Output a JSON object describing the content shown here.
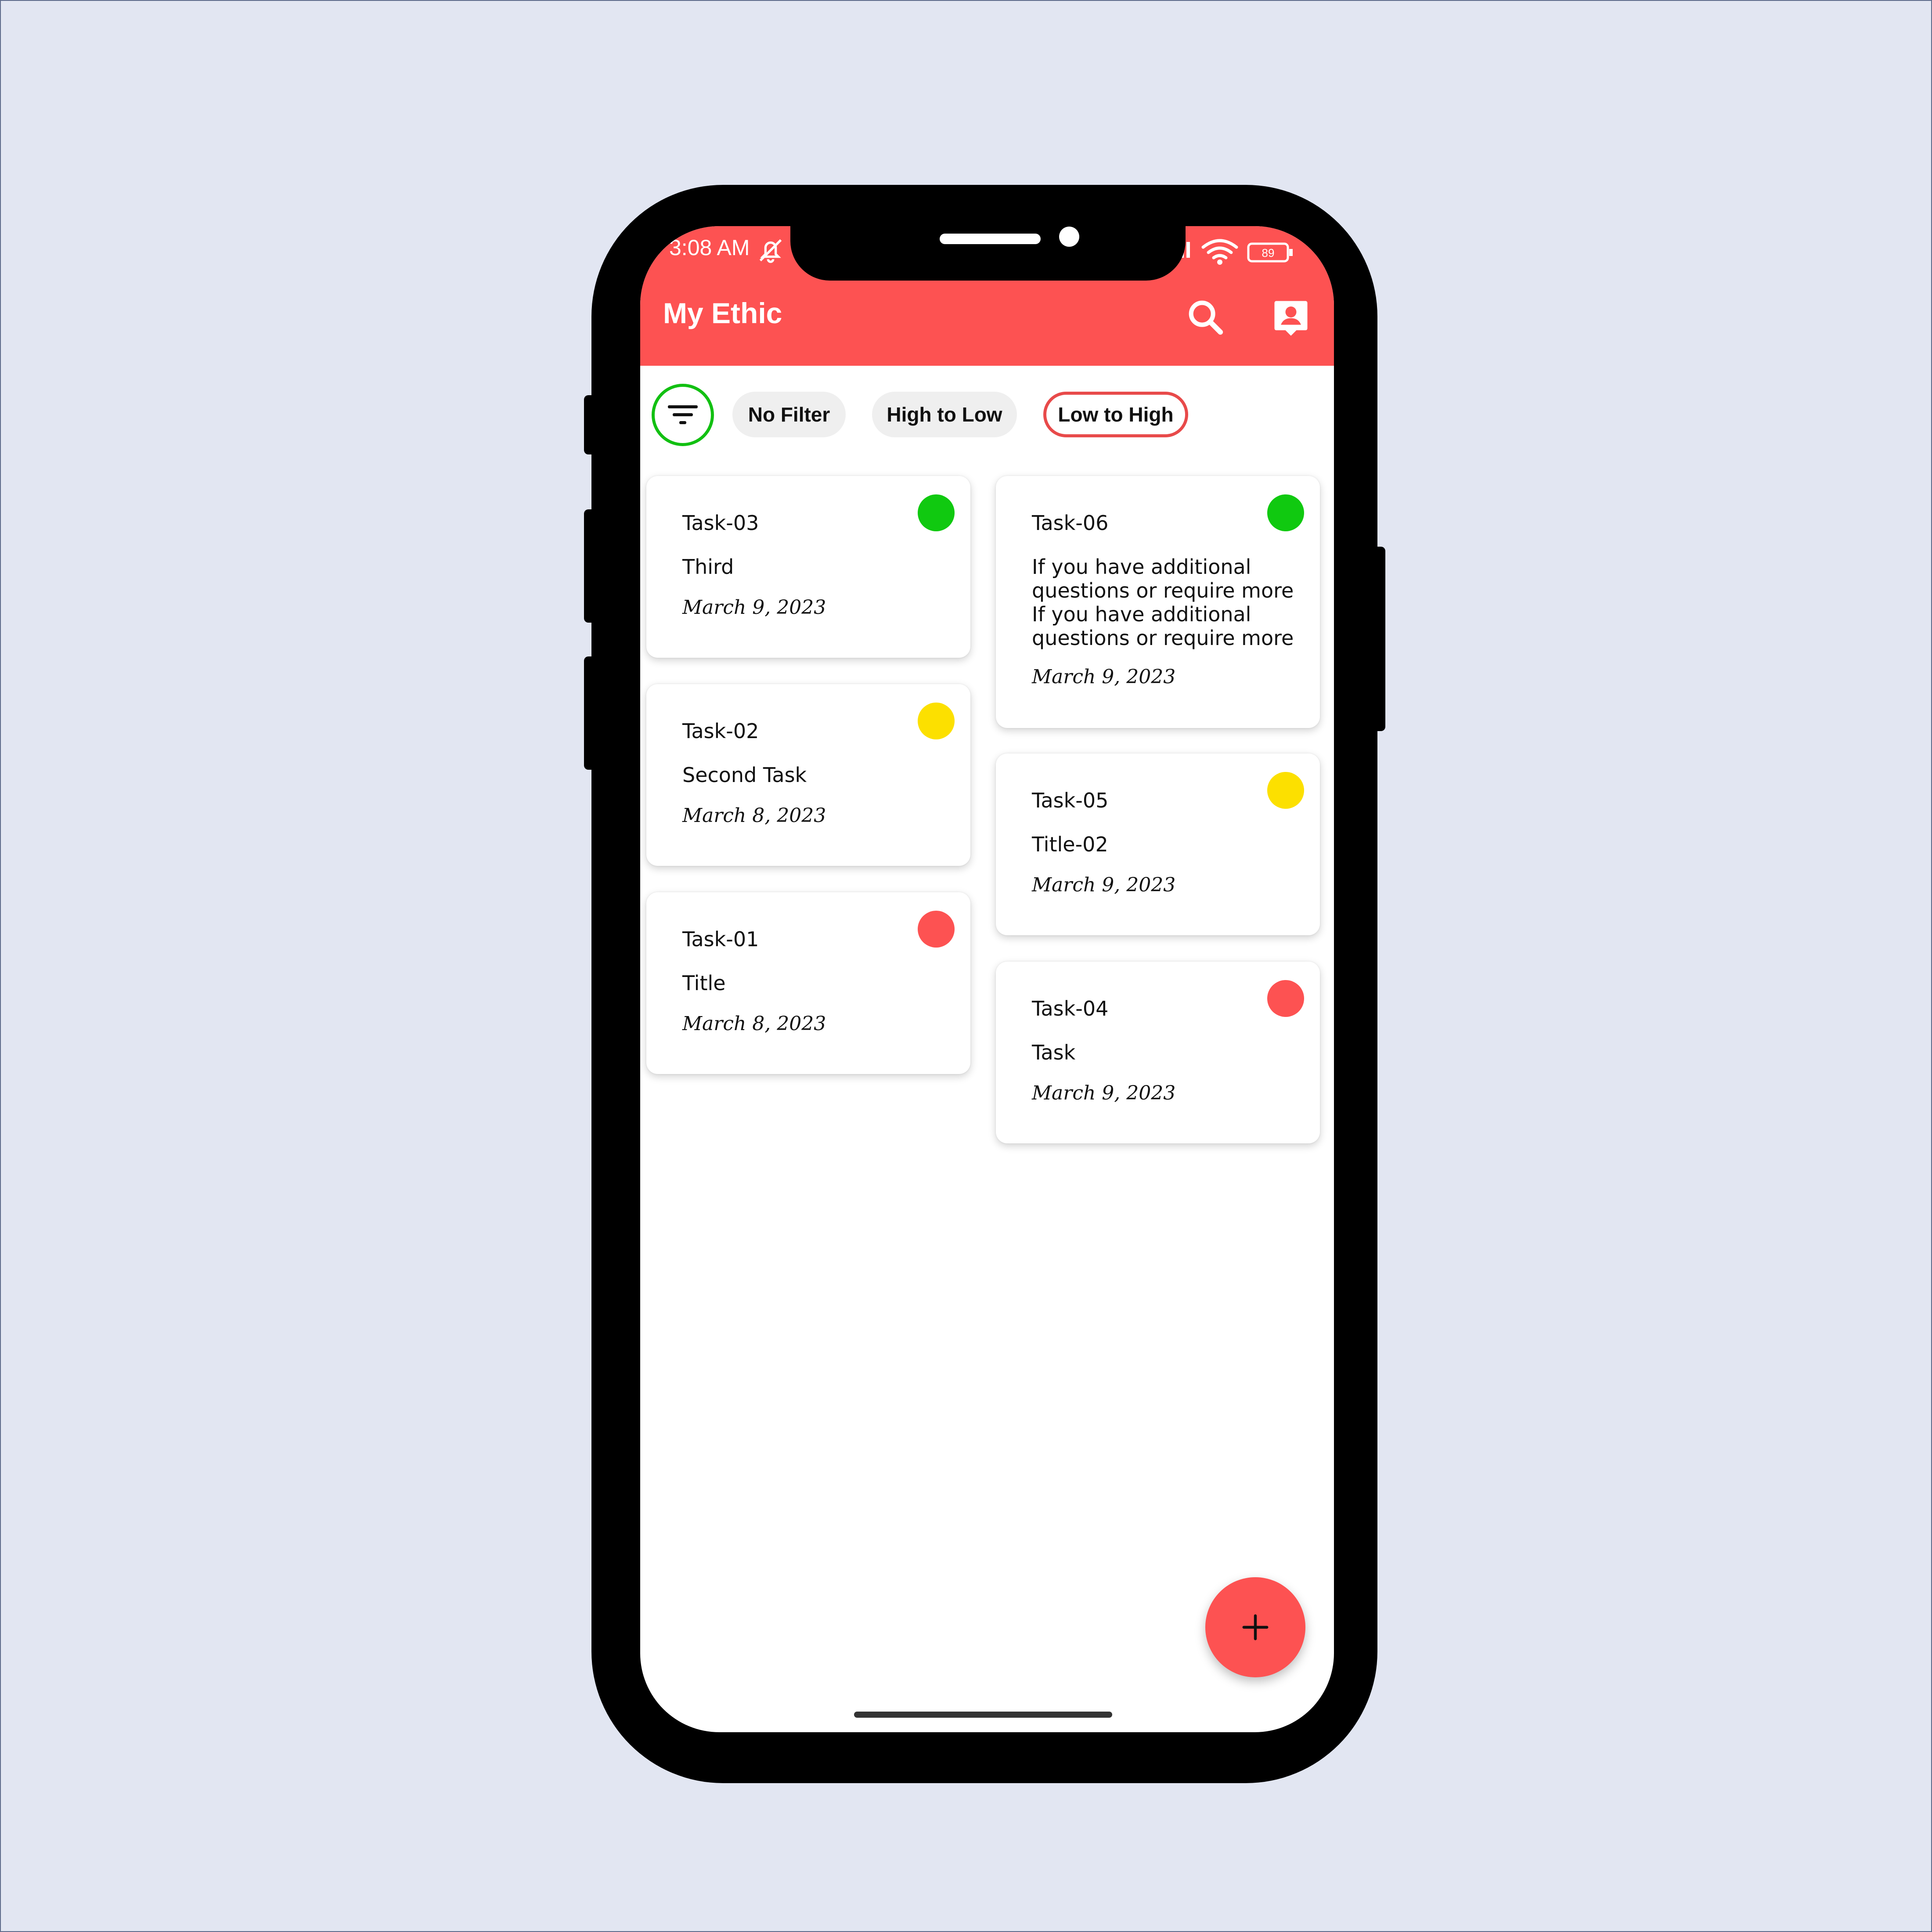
{
  "status_bar": {
    "time": "3:08 AM",
    "battery": "89"
  },
  "app_bar": {
    "title": "My Ethic",
    "search_icon": "search-icon",
    "profile_icon": "account-box-icon"
  },
  "filters": {
    "icon": "filter-list-icon",
    "options": [
      "No Filter",
      "High to Low",
      "Low to High"
    ],
    "selected": "Low to High"
  },
  "tasks_left": [
    {
      "name": "Task-03",
      "desc": "Third",
      "date": "March 9, 2023",
      "priority_color": "#10c910"
    },
    {
      "name": "Task-02",
      "desc": "Second Task",
      "date": "March 8, 2023",
      "priority_color": "#fce000"
    },
    {
      "name": "Task-01",
      "desc": "Title",
      "date": "March 8, 2023",
      "priority_color": "#fd5252"
    }
  ],
  "tasks_right": [
    {
      "name": "Task-06",
      "desc": "If you have additional questions or require more If you have additional questions or require more",
      "date": "March 9, 2023",
      "priority_color": "#10c910"
    },
    {
      "name": "Task-05",
      "desc": "Title-02",
      "date": "March 9, 2023",
      "priority_color": "#fce000"
    },
    {
      "name": "Task-04",
      "desc": "Task",
      "date": "March 9, 2023",
      "priority_color": "#fd5252"
    }
  ],
  "fab": {
    "icon": "plus-icon"
  },
  "colors": {
    "accent": "#fd5252",
    "filter_ring": "#12c012",
    "background": "#e2e6f2"
  }
}
